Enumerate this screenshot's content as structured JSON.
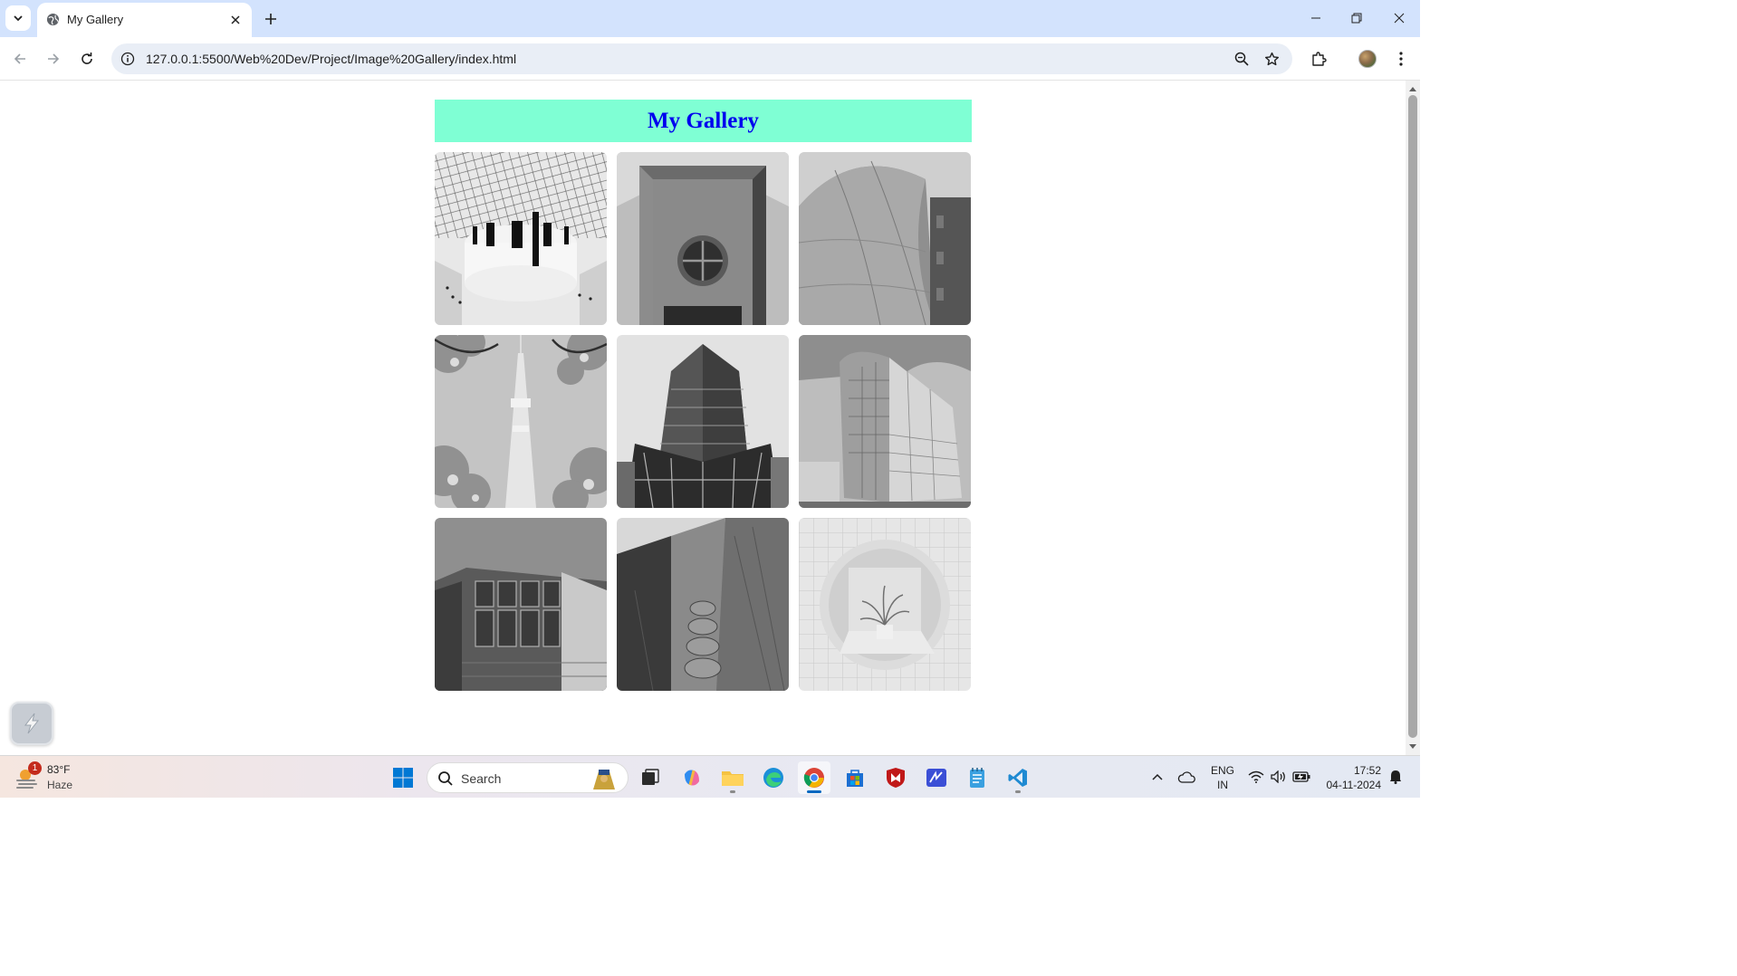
{
  "browser": {
    "tab": {
      "title": "My Gallery",
      "favicon": "globe-icon"
    },
    "address_bar": {
      "url": "127.0.0.1:5500/Web%20Dev/Project/Image%20Gallery/index.html"
    }
  },
  "page": {
    "header": {
      "title": "My Gallery",
      "background": "#7fffd4",
      "text_color": "#0000ee"
    },
    "gallery": {
      "images": [
        {
          "name": "gallery-image-museum-dome",
          "subject": "museum dome interior"
        },
        {
          "name": "gallery-image-building-entrance",
          "subject": "building entrance with round window"
        },
        {
          "name": "gallery-image-curved-facade",
          "subject": "curved metallic facade"
        },
        {
          "name": "gallery-image-tower-blossoms",
          "subject": "tower framed by blossoms"
        },
        {
          "name": "gallery-image-glass-skyscraper",
          "subject": "glass skyscraper"
        },
        {
          "name": "gallery-image-office-building",
          "subject": "office building corner"
        },
        {
          "name": "gallery-image-glass-windows",
          "subject": "glass window grid building"
        },
        {
          "name": "gallery-image-ornate-columns",
          "subject": "ornate stone columns"
        },
        {
          "name": "gallery-image-round-window-plant",
          "subject": "round window with plant"
        }
      ]
    }
  },
  "taskbar": {
    "weather": {
      "temperature": "83°F",
      "condition": "Haze",
      "badge": "1"
    },
    "search": {
      "placeholder": "Search"
    },
    "language": {
      "line1": "ENG",
      "line2": "IN"
    },
    "clock": {
      "time": "17:52",
      "date": "04-11-2024"
    }
  }
}
